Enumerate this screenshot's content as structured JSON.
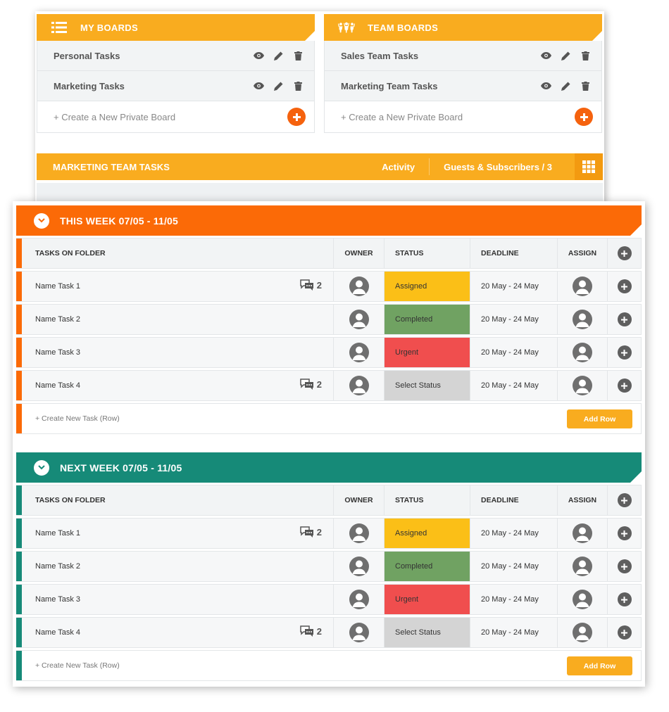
{
  "colors": {
    "accent_yellow": "#f9ac1f",
    "accent_orange": "#fb6a07",
    "accent_teal": "#168a78",
    "status_assigned": "#fbbf17",
    "status_completed": "#70a262",
    "status_urgent": "#f04e4e",
    "status_select": "#d4d4d4"
  },
  "my_boards": {
    "title": "MY BOARDS",
    "icon": "list-icon",
    "items": [
      {
        "label": "Personal Tasks"
      },
      {
        "label": "Marketing Tasks"
      }
    ],
    "create_label": "+ Create a New Private Board"
  },
  "team_boards": {
    "title": "TEAM BOARDS",
    "icon": "team-icon",
    "items": [
      {
        "label": "Sales Team Tasks"
      },
      {
        "label": "Marketing Team Tasks"
      }
    ],
    "create_label": "+ Create a New Private Board"
  },
  "team_bar": {
    "title": "MARKETING TEAM TASKS",
    "activity": "Activity",
    "guests": "Guests & Subscribers / 3"
  },
  "columns": {
    "tasks": "TASKS ON FOLDER",
    "owner": "OWNER",
    "status": "STATUS",
    "deadline": "DEADLINE",
    "assign": "ASSIGN"
  },
  "sections": [
    {
      "title": "THIS WEEK 07/05 - 11/05",
      "tasks": [
        {
          "name": "Name Task 1",
          "comments": "2",
          "status": "Assigned",
          "deadline": "20 May - 24 May"
        },
        {
          "name": "Name Task 2",
          "comments": "",
          "status": "Completed",
          "deadline": "20 May - 24 May"
        },
        {
          "name": "Name Task 3",
          "comments": "",
          "status": "Urgent",
          "deadline": "20 May - 24 May"
        },
        {
          "name": "Name Task 4",
          "comments": "2",
          "status": "Select Status",
          "deadline": "20 May - 24 May"
        }
      ],
      "create_label": "+ Create New Task (Row)",
      "add_row_label": "Add Row"
    },
    {
      "title": "NEXT WEEK 07/05 - 11/05",
      "tasks": [
        {
          "name": "Name Task 1",
          "comments": "2",
          "status": "Assigned",
          "deadline": "20 May - 24 May"
        },
        {
          "name": "Name Task 2",
          "comments": "",
          "status": "Completed",
          "deadline": "20 May - 24 May"
        },
        {
          "name": "Name Task 3",
          "comments": "",
          "status": "Urgent",
          "deadline": "20 May - 24 May"
        },
        {
          "name": "Name Task 4",
          "comments": "2",
          "status": "Select Status",
          "deadline": "20 May - 24 May"
        }
      ],
      "create_label": "+ Create New Task (Row)",
      "add_row_label": "Add Row"
    }
  ]
}
